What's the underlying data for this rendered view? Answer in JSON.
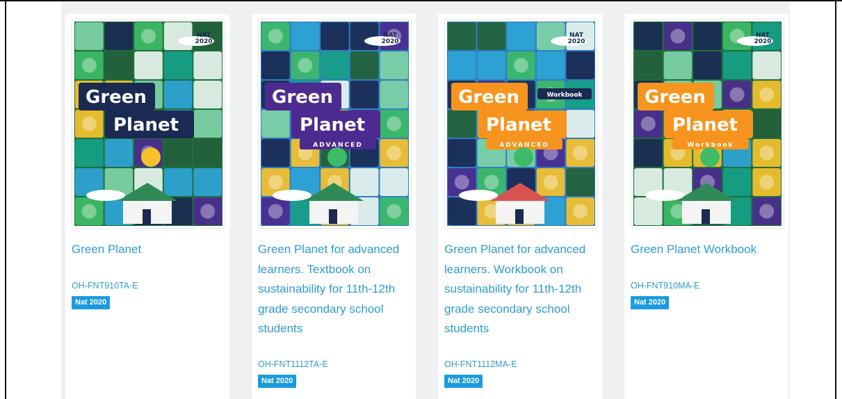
{
  "books": [
    {
      "title": "Green Planet",
      "code": "OH-FNT910TA-E",
      "badge": "Nat 2020",
      "cover": {
        "line1": "Green",
        "line2": "Planet",
        "subtitle": "",
        "corner": "NAT\n2020",
        "bg": "#1f6e3f",
        "panel": "#1a2a52",
        "panel_text": "#ffffff",
        "accent": "#f6c12c"
      }
    },
    {
      "title": "Green Planet for advanced learners. Textbook on sustainability for 11th-12th grade secondary school students",
      "code": "OH-FNT1112TA-E",
      "badge": "Nat 2020",
      "cover": {
        "line1": "Green",
        "line2": "Planet",
        "subtitle": "ADVANCED",
        "corner": "NAT\n2020",
        "bg": "#2f7fbf",
        "panel": "#4c2a8f",
        "panel_text": "#ffffff",
        "accent": "#3dbb67"
      }
    },
    {
      "title": "Green Planet for advanced learners. Workbook on sustainability for 11th-12th grade secondary school students",
      "code": "OH-FNT1112MA-E",
      "badge": "Nat 2020",
      "cover": {
        "line1": "Green",
        "line2": "Planet",
        "subtitle": "ADVANCED",
        "tag": "Workbook",
        "corner": "NAT\n2020",
        "bg": "#2f7fbf",
        "panel": "#f7941d",
        "panel_text": "#ffffff",
        "accent": "#3dbb67"
      }
    },
    {
      "title": "Green Planet Workbook",
      "code": "OH-FNT910MA-E",
      "badge": "Nat 2020",
      "cover": {
        "line1": "Green",
        "line2": "Planet",
        "subtitle": "Workbook",
        "corner": "NAT\n2020",
        "bg": "#1f6e3f",
        "panel": "#f7941d",
        "panel_text": "#ffffff",
        "accent": "#3dbb67"
      }
    }
  ]
}
